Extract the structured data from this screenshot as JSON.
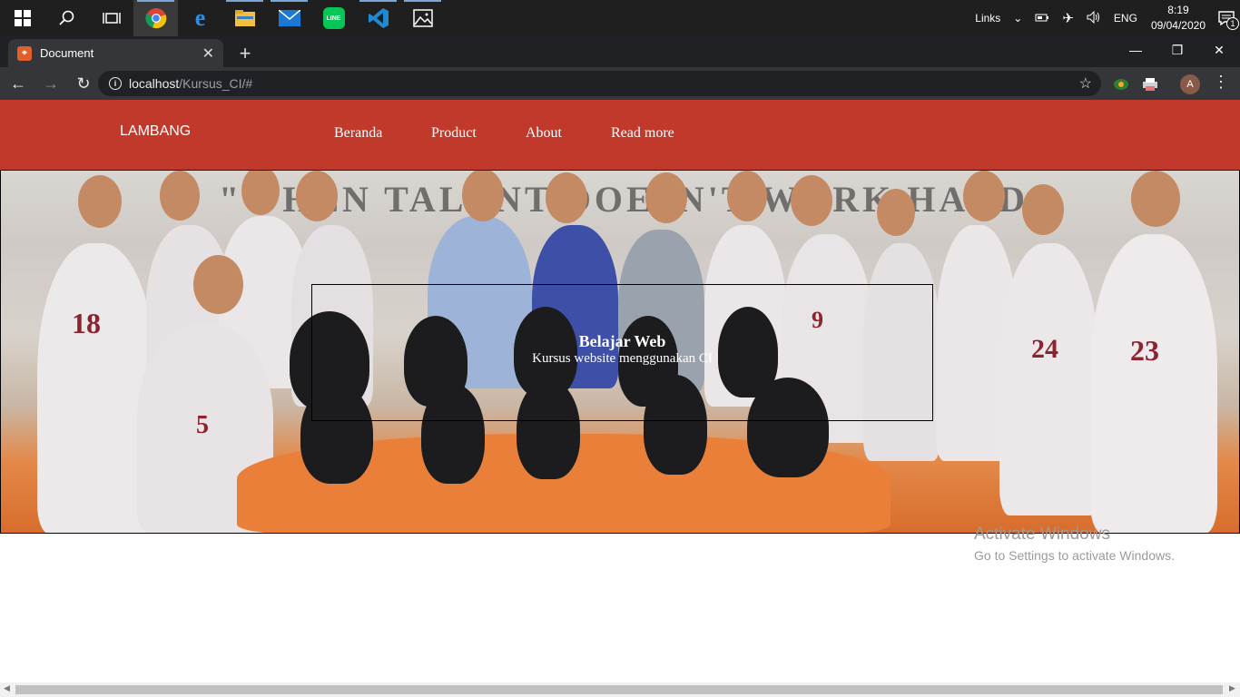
{
  "taskbar": {
    "apps": [
      "windows-start",
      "search",
      "task-view",
      "chrome",
      "edge",
      "file-explorer",
      "mail",
      "line",
      "vscode",
      "photos"
    ],
    "tray": {
      "links_label": "Links",
      "lang": "ENG",
      "time": "8:19",
      "date": "09/04/2020",
      "notification_count": "1"
    }
  },
  "browser": {
    "tab_title": "Document",
    "url_host": "localhost",
    "url_path": "/Kursus_CI/#",
    "profile_initial": "A"
  },
  "page": {
    "brand": "LAMBANG",
    "menu": [
      "Beranda",
      "Product",
      "About",
      "Read more"
    ],
    "hero": {
      "wall_text": "\"WHEN TALENT DOESN'T WORK HARD\"",
      "title": "Belajar Web",
      "subtitle": "Kursus website menggunakan CI"
    }
  },
  "watermark": {
    "line1": "Activate Windows",
    "line2": "Go to Settings to activate Windows."
  },
  "colors": {
    "navbar": "#c0392b",
    "taskbar": "#1f1f1f",
    "chrome_dark": "#35363a"
  }
}
